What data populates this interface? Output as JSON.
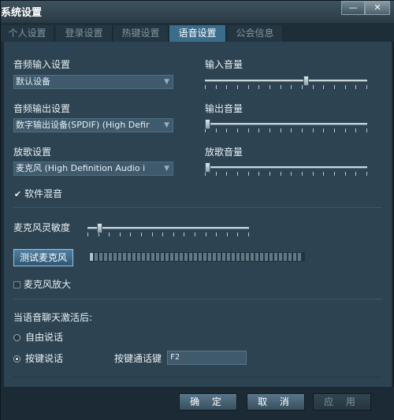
{
  "window": {
    "title": "系统设置",
    "minimize_glyph": "—",
    "close_glyph": "✕"
  },
  "tabs": [
    {
      "label": "个人设置",
      "active": false
    },
    {
      "label": "登录设置",
      "active": false
    },
    {
      "label": "热键设置",
      "active": false
    },
    {
      "label": "语音设置",
      "active": true
    },
    {
      "label": "公会信息",
      "active": false
    }
  ],
  "audio": {
    "input_label": "音频输入设置",
    "input_device": "默认设备",
    "output_label": "音频输出设置",
    "output_device": "数字输出设备(SPDIF) (High Defir",
    "playback_label": "放歌设置",
    "playback_device": "麦克风 (High Definition Audio i",
    "input_volume_label": "输入音量",
    "input_volume_level": 0.63,
    "output_volume_label": "输出音量",
    "output_volume_level": 0.0,
    "playback_volume_label": "放歌音量",
    "playback_volume_level": 0.0,
    "software_mix_label": "软件混音",
    "software_mix_checked": true
  },
  "mic": {
    "sensitivity_label": "麦克风灵敏度",
    "sensitivity_level": 0.06,
    "test_button": "测试麦克风",
    "meter_level": 0.02,
    "boost_label": "麦克风放大",
    "boost_checked": false
  },
  "voice_chat": {
    "heading": "当语音聊天激活后:",
    "free_talk_label": "自由说话",
    "push_to_talk_label": "按键说话",
    "push_to_talk_selected": true,
    "hotkey_label": "按键通话键",
    "hotkey_value": "F2"
  },
  "footer": {
    "ok": "确 定",
    "cancel": "取 消",
    "apply": "应 用"
  },
  "colors": {
    "accent": "#3a6d8c",
    "background": "#2d4352"
  }
}
